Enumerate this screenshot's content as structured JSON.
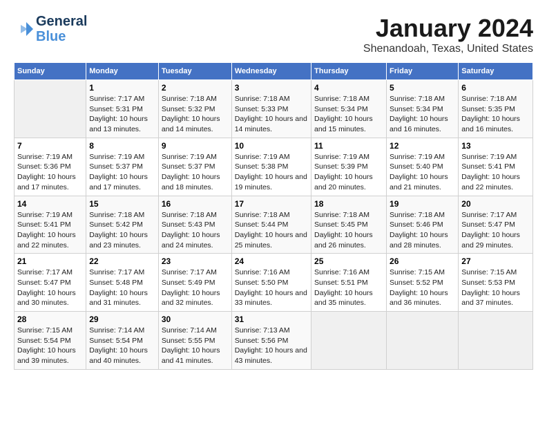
{
  "header": {
    "logo_line1": "General",
    "logo_line2": "Blue",
    "title": "January 2024",
    "subtitle": "Shenandoah, Texas, United States"
  },
  "calendar": {
    "days_of_week": [
      "Sunday",
      "Monday",
      "Tuesday",
      "Wednesday",
      "Thursday",
      "Friday",
      "Saturday"
    ],
    "weeks": [
      [
        {
          "day": "",
          "sunrise": "",
          "sunset": "",
          "daylight": ""
        },
        {
          "day": "1",
          "sunrise": "Sunrise: 7:17 AM",
          "sunset": "Sunset: 5:31 PM",
          "daylight": "Daylight: 10 hours and 13 minutes."
        },
        {
          "day": "2",
          "sunrise": "Sunrise: 7:18 AM",
          "sunset": "Sunset: 5:32 PM",
          "daylight": "Daylight: 10 hours and 14 minutes."
        },
        {
          "day": "3",
          "sunrise": "Sunrise: 7:18 AM",
          "sunset": "Sunset: 5:33 PM",
          "daylight": "Daylight: 10 hours and 14 minutes."
        },
        {
          "day": "4",
          "sunrise": "Sunrise: 7:18 AM",
          "sunset": "Sunset: 5:34 PM",
          "daylight": "Daylight: 10 hours and 15 minutes."
        },
        {
          "day": "5",
          "sunrise": "Sunrise: 7:18 AM",
          "sunset": "Sunset: 5:34 PM",
          "daylight": "Daylight: 10 hours and 16 minutes."
        },
        {
          "day": "6",
          "sunrise": "Sunrise: 7:18 AM",
          "sunset": "Sunset: 5:35 PM",
          "daylight": "Daylight: 10 hours and 16 minutes."
        }
      ],
      [
        {
          "day": "7",
          "sunrise": "Sunrise: 7:19 AM",
          "sunset": "Sunset: 5:36 PM",
          "daylight": "Daylight: 10 hours and 17 minutes."
        },
        {
          "day": "8",
          "sunrise": "Sunrise: 7:19 AM",
          "sunset": "Sunset: 5:37 PM",
          "daylight": "Daylight: 10 hours and 17 minutes."
        },
        {
          "day": "9",
          "sunrise": "Sunrise: 7:19 AM",
          "sunset": "Sunset: 5:37 PM",
          "daylight": "Daylight: 10 hours and 18 minutes."
        },
        {
          "day": "10",
          "sunrise": "Sunrise: 7:19 AM",
          "sunset": "Sunset: 5:38 PM",
          "daylight": "Daylight: 10 hours and 19 minutes."
        },
        {
          "day": "11",
          "sunrise": "Sunrise: 7:19 AM",
          "sunset": "Sunset: 5:39 PM",
          "daylight": "Daylight: 10 hours and 20 minutes."
        },
        {
          "day": "12",
          "sunrise": "Sunrise: 7:19 AM",
          "sunset": "Sunset: 5:40 PM",
          "daylight": "Daylight: 10 hours and 21 minutes."
        },
        {
          "day": "13",
          "sunrise": "Sunrise: 7:19 AM",
          "sunset": "Sunset: 5:41 PM",
          "daylight": "Daylight: 10 hours and 22 minutes."
        }
      ],
      [
        {
          "day": "14",
          "sunrise": "Sunrise: 7:19 AM",
          "sunset": "Sunset: 5:41 PM",
          "daylight": "Daylight: 10 hours and 22 minutes."
        },
        {
          "day": "15",
          "sunrise": "Sunrise: 7:18 AM",
          "sunset": "Sunset: 5:42 PM",
          "daylight": "Daylight: 10 hours and 23 minutes."
        },
        {
          "day": "16",
          "sunrise": "Sunrise: 7:18 AM",
          "sunset": "Sunset: 5:43 PM",
          "daylight": "Daylight: 10 hours and 24 minutes."
        },
        {
          "day": "17",
          "sunrise": "Sunrise: 7:18 AM",
          "sunset": "Sunset: 5:44 PM",
          "daylight": "Daylight: 10 hours and 25 minutes."
        },
        {
          "day": "18",
          "sunrise": "Sunrise: 7:18 AM",
          "sunset": "Sunset: 5:45 PM",
          "daylight": "Daylight: 10 hours and 26 minutes."
        },
        {
          "day": "19",
          "sunrise": "Sunrise: 7:18 AM",
          "sunset": "Sunset: 5:46 PM",
          "daylight": "Daylight: 10 hours and 28 minutes."
        },
        {
          "day": "20",
          "sunrise": "Sunrise: 7:17 AM",
          "sunset": "Sunset: 5:47 PM",
          "daylight": "Daylight: 10 hours and 29 minutes."
        }
      ],
      [
        {
          "day": "21",
          "sunrise": "Sunrise: 7:17 AM",
          "sunset": "Sunset: 5:47 PM",
          "daylight": "Daylight: 10 hours and 30 minutes."
        },
        {
          "day": "22",
          "sunrise": "Sunrise: 7:17 AM",
          "sunset": "Sunset: 5:48 PM",
          "daylight": "Daylight: 10 hours and 31 minutes."
        },
        {
          "day": "23",
          "sunrise": "Sunrise: 7:17 AM",
          "sunset": "Sunset: 5:49 PM",
          "daylight": "Daylight: 10 hours and 32 minutes."
        },
        {
          "day": "24",
          "sunrise": "Sunrise: 7:16 AM",
          "sunset": "Sunset: 5:50 PM",
          "daylight": "Daylight: 10 hours and 33 minutes."
        },
        {
          "day": "25",
          "sunrise": "Sunrise: 7:16 AM",
          "sunset": "Sunset: 5:51 PM",
          "daylight": "Daylight: 10 hours and 35 minutes."
        },
        {
          "day": "26",
          "sunrise": "Sunrise: 7:15 AM",
          "sunset": "Sunset: 5:52 PM",
          "daylight": "Daylight: 10 hours and 36 minutes."
        },
        {
          "day": "27",
          "sunrise": "Sunrise: 7:15 AM",
          "sunset": "Sunset: 5:53 PM",
          "daylight": "Daylight: 10 hours and 37 minutes."
        }
      ],
      [
        {
          "day": "28",
          "sunrise": "Sunrise: 7:15 AM",
          "sunset": "Sunset: 5:54 PM",
          "daylight": "Daylight: 10 hours and 39 minutes."
        },
        {
          "day": "29",
          "sunrise": "Sunrise: 7:14 AM",
          "sunset": "Sunset: 5:54 PM",
          "daylight": "Daylight: 10 hours and 40 minutes."
        },
        {
          "day": "30",
          "sunrise": "Sunrise: 7:14 AM",
          "sunset": "Sunset: 5:55 PM",
          "daylight": "Daylight: 10 hours and 41 minutes."
        },
        {
          "day": "31",
          "sunrise": "Sunrise: 7:13 AM",
          "sunset": "Sunset: 5:56 PM",
          "daylight": "Daylight: 10 hours and 43 minutes."
        },
        {
          "day": "",
          "sunrise": "",
          "sunset": "",
          "daylight": ""
        },
        {
          "day": "",
          "sunrise": "",
          "sunset": "",
          "daylight": ""
        },
        {
          "day": "",
          "sunrise": "",
          "sunset": "",
          "daylight": ""
        }
      ]
    ]
  }
}
